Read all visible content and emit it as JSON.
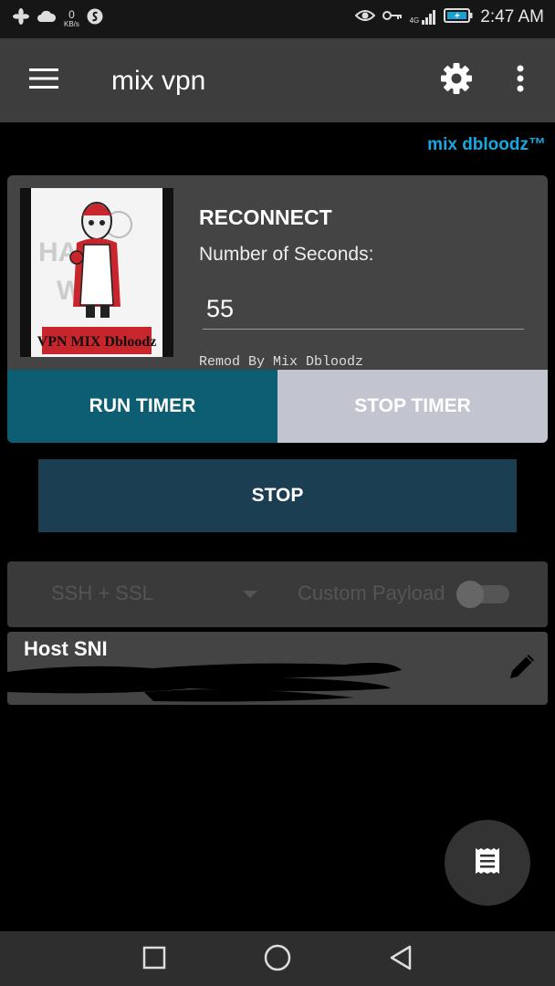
{
  "status_bar": {
    "netspeed_value": "0",
    "netspeed_unit": "KB/s",
    "network_type": "4G",
    "time": "2:47 AM"
  },
  "toolbar": {
    "title": "mix vpn",
    "icons": [
      "menu-icon",
      "settings-icon",
      "more-vert-icon"
    ]
  },
  "brand": {
    "text": "mix dbloodz™",
    "color": "#18a8e0"
  },
  "reconnect_card": {
    "title": "RECONNECT",
    "seconds_label": "Number of Seconds:",
    "seconds_value": "55",
    "remod_text": "Remod By Mix Dbloodz",
    "logo_text": "VPN MIX Dbloodz",
    "run_timer_label": "RUN TIMER",
    "stop_timer_label": "STOP TIMER"
  },
  "stop_button": {
    "label": "STOP"
  },
  "mode_row": {
    "selected_mode": "SSH + SSL",
    "payload_label": "Custom Payload",
    "payload_enabled": false
  },
  "host_card": {
    "label": "Host SNI"
  },
  "colors": {
    "toolbar": "#3d3d3d",
    "run_timer": "#0d5e72",
    "stop_timer": "#c2c4cf",
    "stop_button": "#1b3e53",
    "card": "#444444"
  },
  "nav": {
    "icons": [
      "recent-apps-icon",
      "home-icon",
      "back-icon"
    ]
  }
}
